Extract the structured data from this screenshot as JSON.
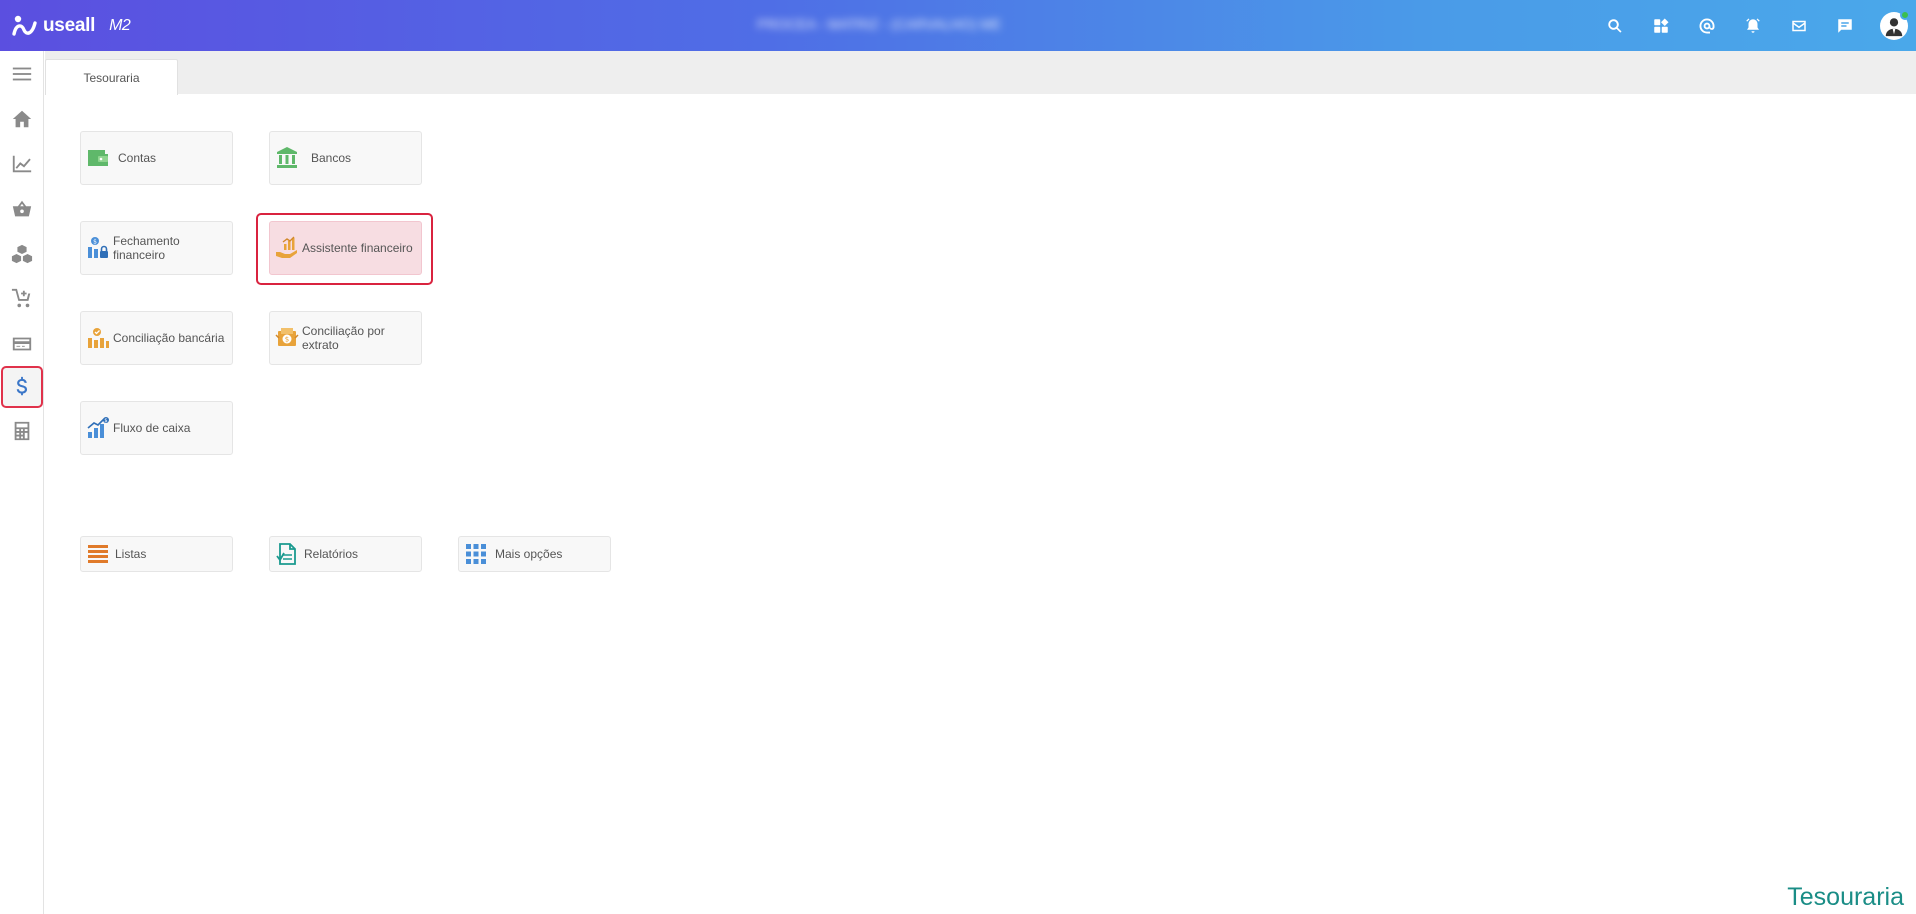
{
  "header": {
    "brand": "useall",
    "version": "M2",
    "window_title": "PROCEA - MATRIZ - (CARVALHO) ME"
  },
  "tabs": [
    {
      "label": "Tesouraria"
    }
  ],
  "tiles": {
    "contas": "Contas",
    "bancos": "Bancos",
    "fechamento": "Fechamento financeiro",
    "assistente": "Assistente financeiro",
    "conciliacao_bancaria": "Conciliação bancária",
    "conciliacao_extrato": "Conciliação por extrato",
    "fluxo_caixa": "Fluxo de caixa",
    "listas": "Listas",
    "relatorios": "Relatórios",
    "mais_opcoes": "Mais opções"
  },
  "footer": {
    "module_title": "Tesouraria"
  },
  "colors": {
    "accent": "#3a76c8",
    "highlight": "#d9233f",
    "footer": "#1a8d86"
  }
}
